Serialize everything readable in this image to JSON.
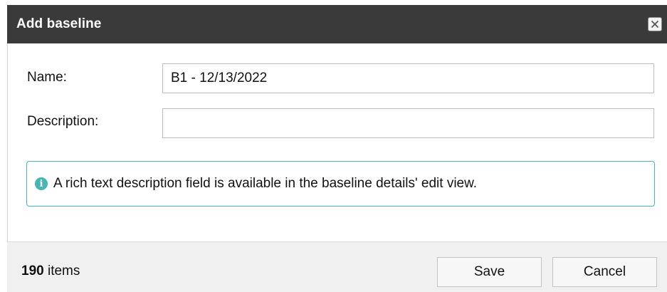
{
  "dialog": {
    "title": "Add baseline",
    "close_icon": "close-x-icon"
  },
  "form": {
    "name_label": "Name:",
    "name_value": "B1 - 12/13/2022",
    "description_label": "Description:",
    "description_value": "",
    "description_placeholder": ""
  },
  "info": {
    "icon": "info-circle-icon",
    "text": "A rich text description field is available in the baseline details' edit view."
  },
  "footer": {
    "count": "190",
    "count_suffix": " items",
    "save_label": "Save",
    "cancel_label": "Cancel"
  },
  "colors": {
    "titlebar": "#3a3a3a",
    "info_accent": "#45b6b4"
  }
}
